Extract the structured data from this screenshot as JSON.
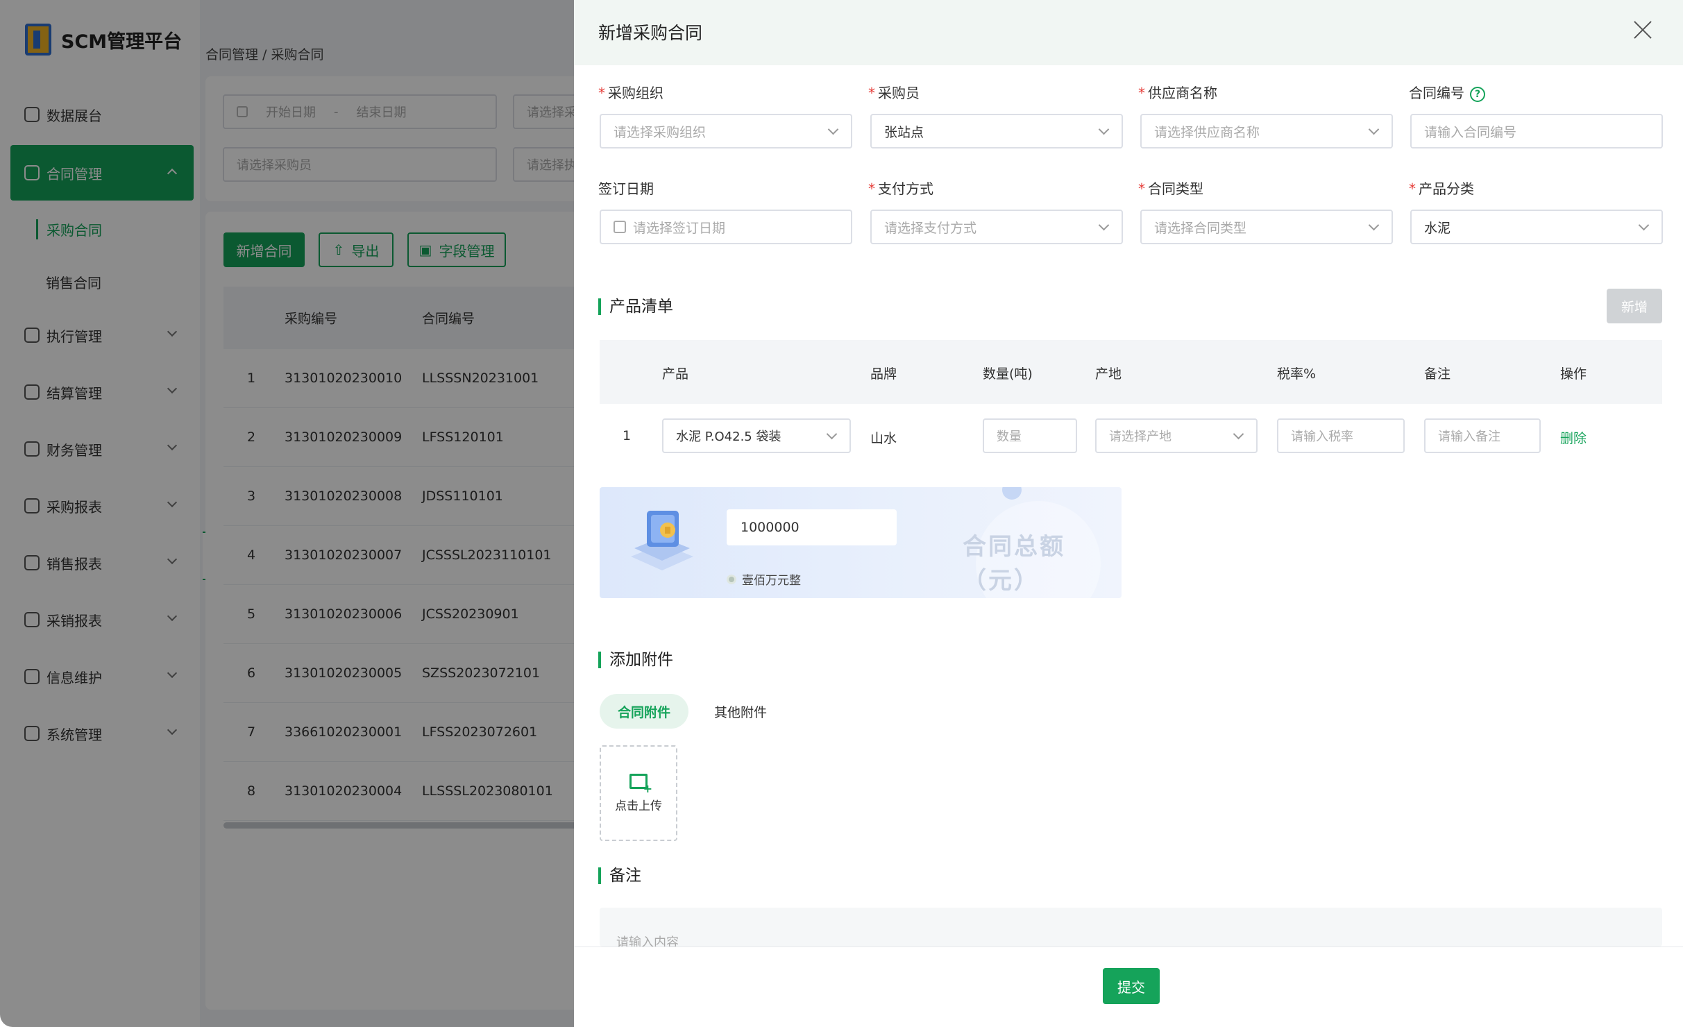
{
  "app": {
    "logo_text": "SCM管理平台",
    "accent_color": "#15a35a"
  },
  "sidebar": {
    "items": [
      {
        "label": "数据展台",
        "icon": "dashboard-icon"
      },
      {
        "label": "合同管理",
        "icon": "contract-icon",
        "active": true
      },
      {
        "label": "执行管理",
        "icon": "execution-icon"
      },
      {
        "label": "结算管理",
        "icon": "settlement-icon"
      },
      {
        "label": "财务管理",
        "icon": "finance-icon"
      },
      {
        "label": "采购报表",
        "icon": "purchase-report-icon"
      },
      {
        "label": "销售报表",
        "icon": "sales-report-icon"
      },
      {
        "label": "采销报表",
        "icon": "purchase-sales-report-icon"
      },
      {
        "label": "信息维护",
        "icon": "info-maintenance-icon"
      },
      {
        "label": "系统管理",
        "icon": "system-icon"
      }
    ],
    "sub_items": [
      "采购合同",
      "销售合同"
    ],
    "collapse_glyph": "«"
  },
  "main": {
    "breadcrumb": "合同管理 / 采购合同",
    "filters": {
      "start_date": "开始日期",
      "date_sep": "-",
      "end_date": "结束日期",
      "select_purchaser": "请选择采购员",
      "select_other": "请选择采",
      "select_exec": "请选择执"
    },
    "buttons": {
      "new_contract": "新增合同",
      "export": "导出",
      "field_manage": "字段管理"
    },
    "table": {
      "headers": [
        "采购编号",
        "合同编号"
      ],
      "rows": [
        {
          "idx": "1",
          "purchase_no": "31301020230010",
          "contract_no": "LLSSSN20231001"
        },
        {
          "idx": "2",
          "purchase_no": "31301020230009",
          "contract_no": "LFSS120101"
        },
        {
          "idx": "3",
          "purchase_no": "31301020230008",
          "contract_no": "JDSS110101"
        },
        {
          "idx": "4",
          "purchase_no": "31301020230007",
          "contract_no": "JCSSSL2023110101"
        },
        {
          "idx": "5",
          "purchase_no": "31301020230006",
          "contract_no": "JCSS20230901"
        },
        {
          "idx": "6",
          "purchase_no": "31301020230005",
          "contract_no": "SZSS2023072101"
        },
        {
          "idx": "7",
          "purchase_no": "33661020230001",
          "contract_no": "LFSS2023072601"
        },
        {
          "idx": "8",
          "purchase_no": "31301020230004",
          "contract_no": "LLSSSL2023080101"
        }
      ]
    }
  },
  "drawer": {
    "title": "新增采购合同",
    "form": {
      "org": {
        "label": "采购组织",
        "required": "*",
        "placeholder": "请选择采购组织"
      },
      "buyer": {
        "label": "采购员",
        "required": "*",
        "value": "张站点"
      },
      "supplier": {
        "label": "供应商名称",
        "required": "*",
        "placeholder": "请选择供应商名称"
      },
      "contract_no": {
        "label": "合同编号",
        "help": "?",
        "placeholder": "请输入合同编号"
      },
      "sign_date": {
        "label": "签订日期",
        "placeholder": "请选择签订日期"
      },
      "payment": {
        "label": "支付方式",
        "required": "*",
        "placeholder": "请选择支付方式"
      },
      "contract_type": {
        "label": "合同类型",
        "required": "*",
        "placeholder": "请选择合同类型"
      },
      "category": {
        "label": "产品分类",
        "required": "*",
        "value": "水泥"
      }
    },
    "product_section": {
      "title": "产品清单",
      "add_button": "新增",
      "headers": [
        "产品",
        "品牌",
        "数量(吨)",
        "产地",
        "税率%",
        "备注",
        "操作"
      ],
      "row": {
        "idx": "1",
        "product": "水泥 P.O42.5 袋装",
        "brand": "山水",
        "qty_placeholder": "数量",
        "origin_placeholder": "请选择产地",
        "tax_placeholder": "请输入税率",
        "remark_placeholder": "请输入备注",
        "action": "删除"
      }
    },
    "total": {
      "value": "1000000",
      "caption": "合同总额（元）",
      "in_words": "壹佰万元整"
    },
    "attachment_section": {
      "title": "添加附件",
      "tabs": [
        "合同附件",
        "其他附件"
      ],
      "upload_label": "点击上传"
    },
    "remark_section": {
      "title": "备注",
      "placeholder": "请输入内容"
    },
    "submit": "提交"
  }
}
